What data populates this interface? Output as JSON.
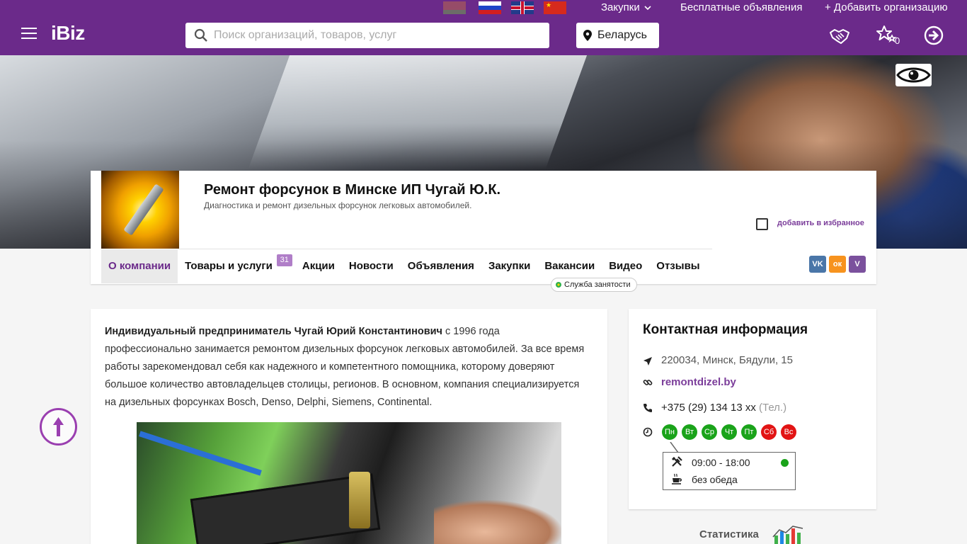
{
  "topbar": {
    "flags": [
      "belarus-flag",
      "russia-flag",
      "uk-flag",
      "china-flag"
    ],
    "procurement_label": "Закупки",
    "free_ads_label": "Бесплатные объявления",
    "add_org_label": "+ Добавить организацию"
  },
  "header": {
    "logo": "iBiz",
    "search_placeholder": "Поиск организаций, товаров, услуг",
    "region": "Беларусь",
    "favorites_count": "0",
    "brand_color": "#6b2a8a"
  },
  "company": {
    "title": "Ремонт форсунок в Минске ИП Чугай Ю.К.",
    "subtitle": "Диагностика и ремонт дизельных форсунок легковых автомобилей.",
    "favorite_label": "добавить в избранное"
  },
  "tabs": [
    {
      "label": "О компании",
      "active": true
    },
    {
      "label": "Товары и услуги",
      "badge": "31"
    },
    {
      "label": "Акции"
    },
    {
      "label": "Новости"
    },
    {
      "label": "Объявления"
    },
    {
      "label": "Закупки"
    },
    {
      "label": "Вакансии"
    },
    {
      "label": "Видео"
    },
    {
      "label": "Отзывы"
    }
  ],
  "employment_label": "Служба занятости",
  "social": [
    {
      "name": "vk",
      "label": "VK",
      "color": "#4a76a8"
    },
    {
      "name": "ok",
      "label": "ок",
      "color": "#f7931e"
    },
    {
      "name": "viber",
      "label": "V",
      "color": "#7b519d"
    }
  ],
  "about": {
    "lead": "Индивидуальный предприниматель Чугай Юрий Константинович",
    "body": "  с 1996 года профессионально занимается ремонтом дизельных форсунок легковых автомобилей. За все время работы зарекомендовал себя как надежного и компетентного помощника, которому доверяют большое количество автовладельцев столицы, регионов. В основном, компания специализируется на дизельных форсунках Bosch, Denso, Delphi, Siemens, Continental."
  },
  "contact": {
    "title": "Контактная информация",
    "address": "220034, Минск, Бядули, 15",
    "website": "remontdizel.by",
    "phone": "+375 (29) 134 13 xx",
    "phone_note": "(Тел.)",
    "days": [
      {
        "label": "Пн",
        "open": true
      },
      {
        "label": "Вт",
        "open": true
      },
      {
        "label": "Ср",
        "open": true
      },
      {
        "label": "Чт",
        "open": true
      },
      {
        "label": "Пт",
        "open": true
      },
      {
        "label": "Сб",
        "open": false
      },
      {
        "label": "Вс",
        "open": false
      }
    ],
    "hours": "09:00 - 18:00",
    "lunch": "без обеда",
    "open_color": "#1aa31a",
    "closed_color": "#e21414"
  },
  "stats_label": "Статистика"
}
